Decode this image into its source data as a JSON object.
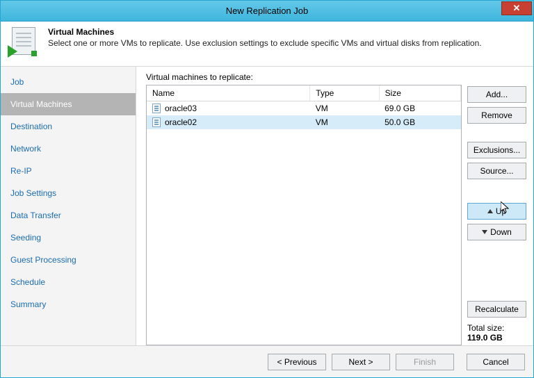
{
  "window": {
    "title": "New Replication Job"
  },
  "header": {
    "title": "Virtual Machines",
    "description": "Select one or more VMs to replicate. Use exclusion settings to exclude specific VMs and virtual disks from replication."
  },
  "sidebar": {
    "items": [
      {
        "label": "Job",
        "active": false
      },
      {
        "label": "Virtual Machines",
        "active": true
      },
      {
        "label": "Destination",
        "active": false
      },
      {
        "label": "Network",
        "active": false
      },
      {
        "label": "Re-IP",
        "active": false
      },
      {
        "label": "Job Settings",
        "active": false
      },
      {
        "label": "Data Transfer",
        "active": false
      },
      {
        "label": "Seeding",
        "active": false
      },
      {
        "label": "Guest Processing",
        "active": false
      },
      {
        "label": "Schedule",
        "active": false
      },
      {
        "label": "Summary",
        "active": false
      }
    ]
  },
  "main": {
    "list_label": "Virtual machines to replicate:",
    "columns": {
      "name": "Name",
      "type": "Type",
      "size": "Size"
    },
    "rows": [
      {
        "name": "oracle03",
        "type": "VM",
        "size": "69.0 GB",
        "selected": false
      },
      {
        "name": "oracle02",
        "type": "VM",
        "size": "50.0 GB",
        "selected": true
      }
    ],
    "total_label": "Total size:",
    "total_value": "119.0 GB"
  },
  "buttons": {
    "add": "Add...",
    "remove": "Remove",
    "exclusions": "Exclusions...",
    "source": "Source...",
    "up": "Up",
    "down": "Down",
    "recalculate": "Recalculate"
  },
  "footer": {
    "previous": "< Previous",
    "next": "Next >",
    "finish": "Finish",
    "cancel": "Cancel"
  }
}
